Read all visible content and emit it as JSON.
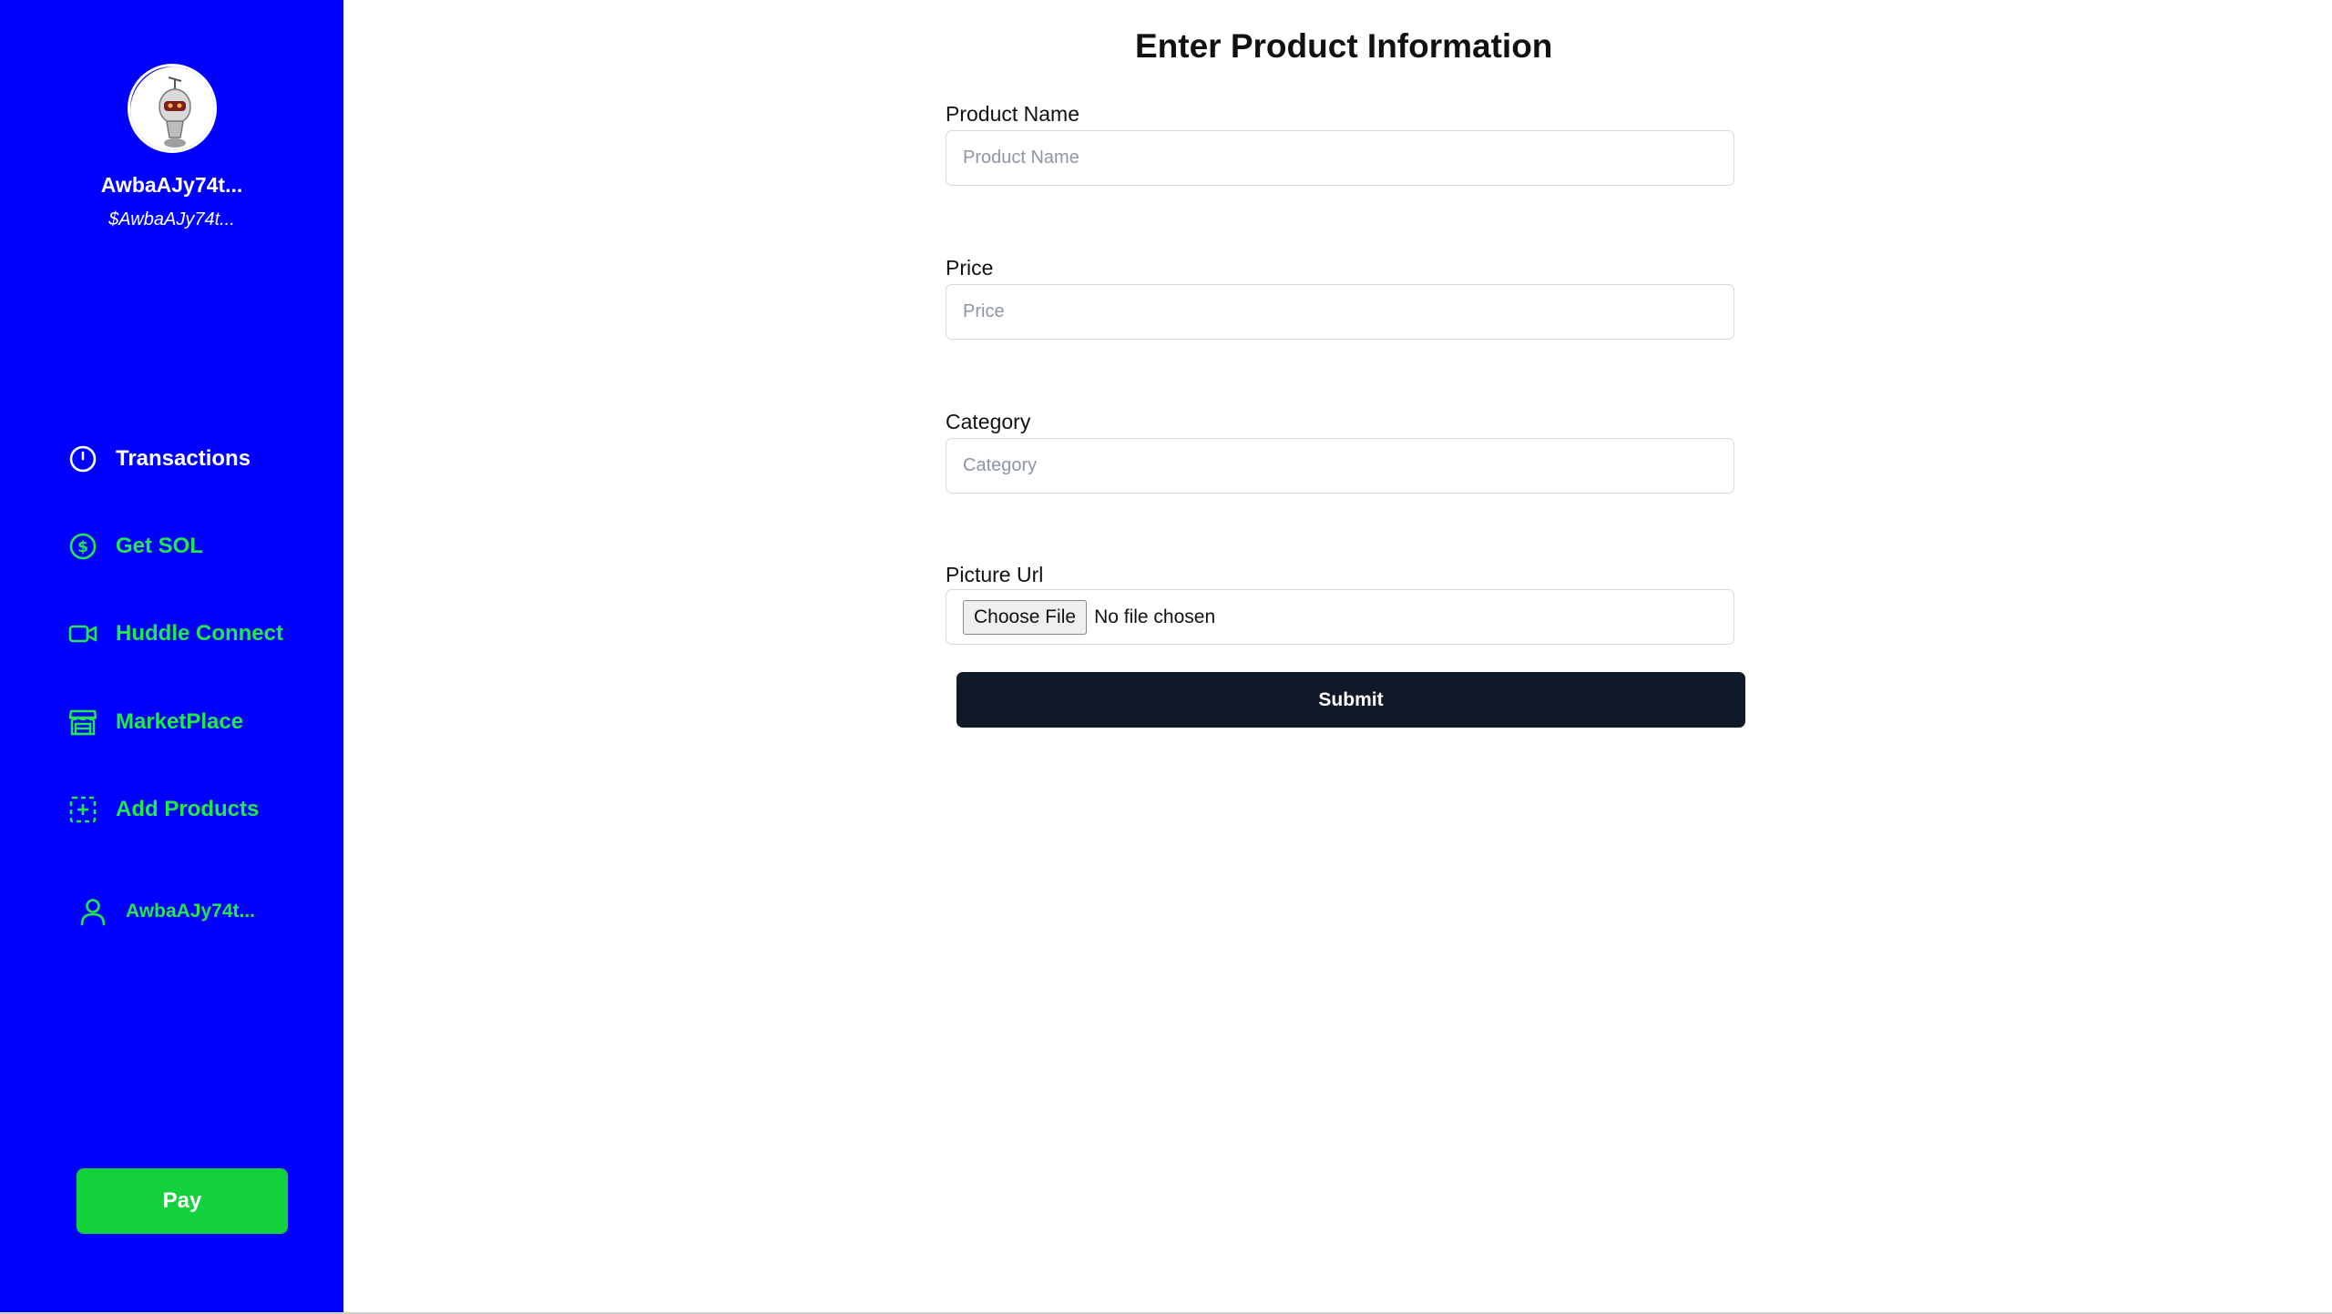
{
  "sidebar": {
    "user_name": "AwbaAJy74t...",
    "user_handle": "$AwbaAJy74t...",
    "items": [
      {
        "label": "Transactions",
        "icon": "clock-icon"
      },
      {
        "label": "Get SOL",
        "icon": "dollar-circle-icon"
      },
      {
        "label": "Huddle Connect",
        "icon": "video-camera-icon"
      },
      {
        "label": "MarketPlace",
        "icon": "storefront-icon"
      },
      {
        "label": "Add Products",
        "icon": "add-square-icon"
      }
    ],
    "profile_label": "AwbaAJy74t...",
    "pay_label": "Pay",
    "colors": {
      "background": "#0000ff",
      "accent": "#22e84a",
      "pay": "#13d13a"
    }
  },
  "form": {
    "title": "Enter Product Information",
    "fields": [
      {
        "label": "Product Name",
        "placeholder": "Product Name",
        "value": ""
      },
      {
        "label": "Price",
        "placeholder": "Price",
        "value": ""
      },
      {
        "label": "Category",
        "placeholder": "Category",
        "value": ""
      }
    ],
    "picture": {
      "label": "Picture Url",
      "button_label": "Choose File",
      "status": "No file chosen"
    },
    "submit_label": "Submit",
    "colors": {
      "submit": "#111827"
    }
  }
}
